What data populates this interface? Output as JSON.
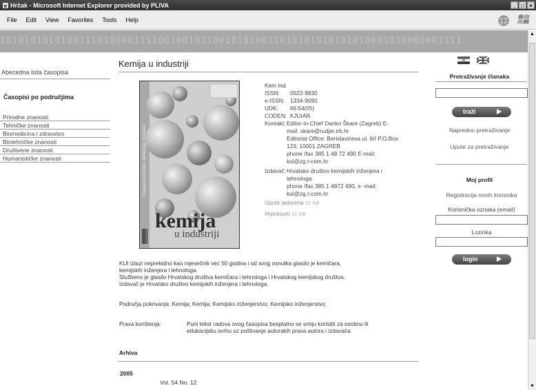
{
  "window": {
    "title": "Hrčak - Microsoft Internet Explorer provided by PLIVA",
    "buttons": [
      "_",
      "□",
      "×"
    ]
  },
  "menu": [
    {
      "label": "File"
    },
    {
      "label": "Edit"
    },
    {
      "label": "View"
    },
    {
      "label": "Favorites"
    },
    {
      "label": "Tools"
    },
    {
      "label": "Help"
    }
  ],
  "banner_text": "1010101010100111010000111100100101100101010011010101010101010001010000001111",
  "left_nav": {
    "alpha_link": "Abecedna lista časopisa",
    "section_head": "Časopisi po područjima",
    "items": [
      "Prirodne znanosti",
      "Tehničke znanosti",
      "Biomedicina i zdravstvo",
      "Biotehničke znanosti",
      "Društvene znanosti",
      "Humanističke znanosti"
    ]
  },
  "main": {
    "title": "Kemija u industriji",
    "cover": {
      "title_main": "kemija",
      "title_sub": "u industriji",
      "spine": "Časopis kemičara i tehnologa Hrvatske"
    },
    "meta": {
      "abbr": "Kem ind.",
      "issn_label": "ISSN:",
      "issn": "0022-9830",
      "eissn_label": "e-ISSN:",
      "eissn": "1334-9090",
      "udk_label": "UDK:",
      "udk": "66:54(05)",
      "coden_label": "CODEN:",
      "coden": "KJUIAR",
      "contact_label": "Kontakt:",
      "contact_lines": [
        "Editor-in-Chief Danko Škare (Zagreb) E-",
        "mail: skare@rudjer.irb.hr",
        "Editorial Office: Berislavićeva ul. 6/I P.O.Box",
        "123; 10001 ZAGREB",
        "phone /fax 385 1 48 72 490 E-mail:",
        "kui@zg.t-com.hr"
      ],
      "publisher_label": "Izdavač:",
      "publisher_lines": [
        "Hrvatsko društvo kemijskih inženjera i",
        "tehnologa",
        "phone /fax 385 1 4872 490, e -mail:",
        "kui@zg.t-com.hr"
      ],
      "author_guide": "Upute autorima",
      "author_guide_size": "51 KB",
      "impressum": "Impresum",
      "impressum_size": "31 KB"
    },
    "description_lines": [
      "KUI izlazi neprekidno kao mjesečnik već 50 godina i od svog osnutka glasilo je kemičara,",
      "kemijskih inženjera i tehnologa.",
      "Službeno je glasilo Hrvatskog društva kemičara i tehnologa i Hrvatskog kemijskog društva.",
      "Izdavač je Hrvatsko društvo kemijskih inženjera i tehnologa."
    ],
    "areas": "Područja pokrivanja: Kemija; Kemija; Kemijsko inženjerstvo; Kemijsko inženjerstvo;",
    "rights_label": "Prava korištenja:",
    "rights_lines": [
      "Puni tekst radova ovog časopisa besplatno se smiju koristiti za osobnu ili",
      "edukacijsku svrhu uz poštivanje autorskih prava autora i izdavača"
    ],
    "archive_head": "Arhiva",
    "year": "2005",
    "vol_no": "Vol. 54  No. 12"
  },
  "right": {
    "search_head": "Pretraživanje članaka",
    "search_btn": "traži",
    "adv_search": "Napredno pretraživanje",
    "search_help": "Upute za pretraživanje",
    "profile_head": "Moj profil",
    "register": "Registracija novih korisnika",
    "user_label": "Korisnička oznaka (email)",
    "pass_label": "Lozinka",
    "login_btn": "login"
  }
}
